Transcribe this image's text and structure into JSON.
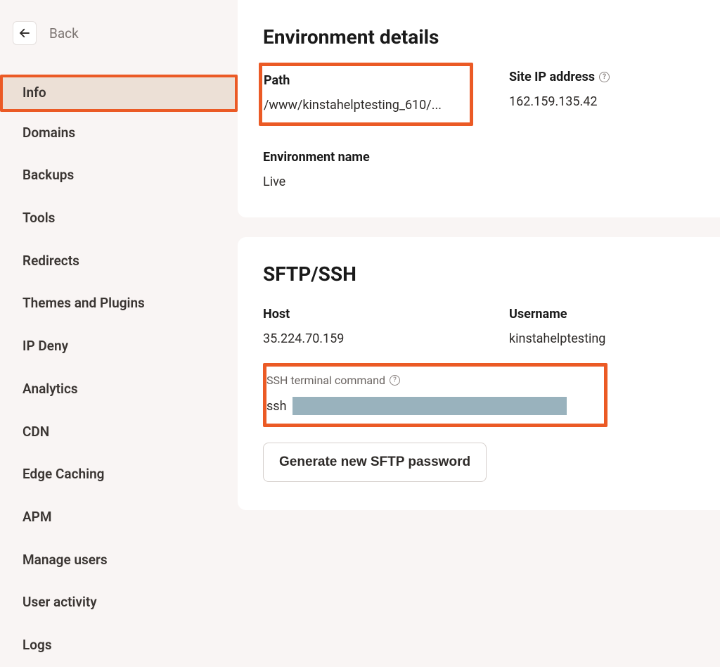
{
  "back_label": "Back",
  "sidebar": {
    "items": [
      {
        "label": "Info",
        "active": true
      },
      {
        "label": "Domains"
      },
      {
        "label": "Backups"
      },
      {
        "label": "Tools"
      },
      {
        "label": "Redirects"
      },
      {
        "label": "Themes and Plugins"
      },
      {
        "label": "IP Deny"
      },
      {
        "label": "Analytics"
      },
      {
        "label": "CDN"
      },
      {
        "label": "Edge Caching"
      },
      {
        "label": "APM"
      },
      {
        "label": "Manage users"
      },
      {
        "label": "User activity"
      },
      {
        "label": "Logs"
      }
    ]
  },
  "env": {
    "heading": "Environment details",
    "path_label": "Path",
    "path_value": "/www/kinstahelptesting_610/...",
    "ip_label": "Site IP address",
    "ip_value": "162.159.135.42",
    "name_label": "Environment name",
    "name_value": "Live"
  },
  "sftp": {
    "heading": "SFTP/SSH",
    "host_label": "Host",
    "host_value": "35.224.70.159",
    "user_label": "Username",
    "user_value": "kinstahelptesting",
    "ssh_cmd_label": "SSH terminal command",
    "ssh_prefix": "ssh",
    "generate_btn": "Generate new SFTP password"
  }
}
